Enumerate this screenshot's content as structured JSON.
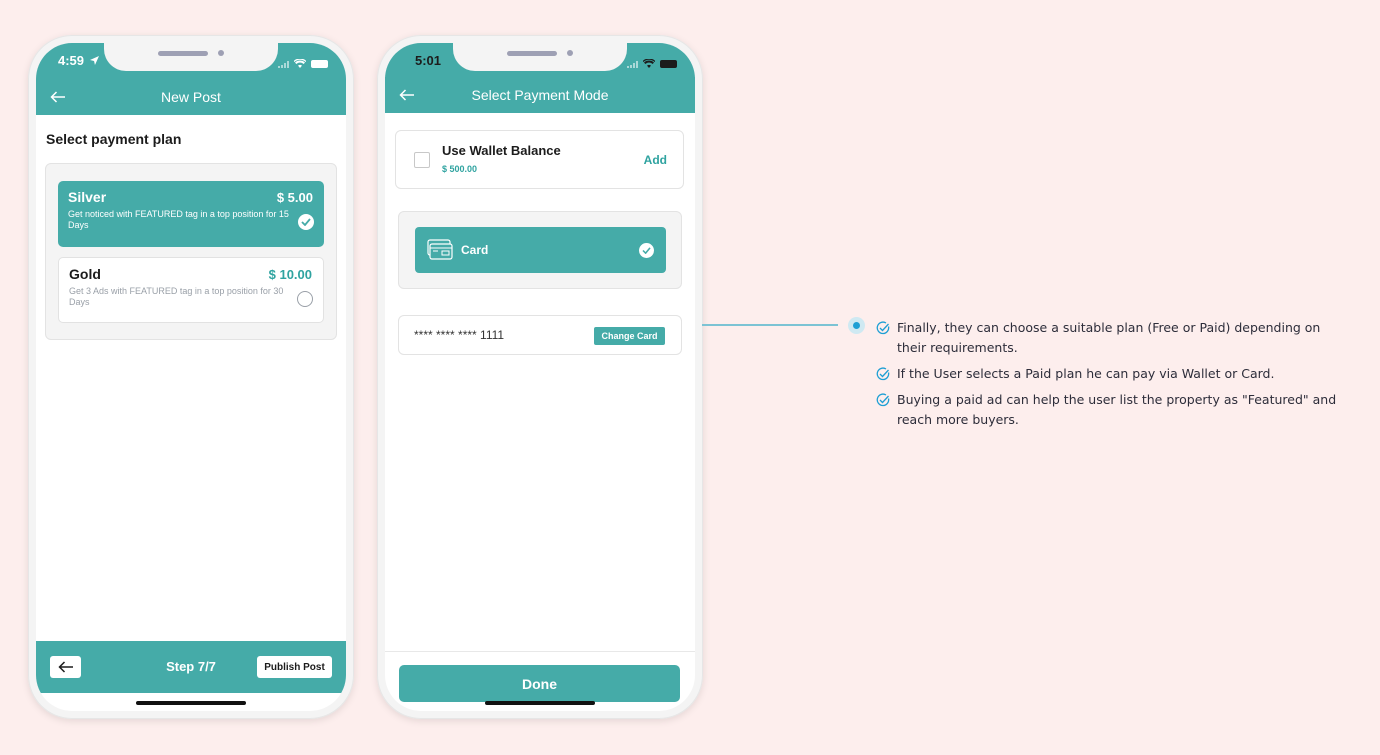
{
  "colors": {
    "primary": "#45aba8",
    "accent_text": "#2fa3a0",
    "background": "#fdeeed",
    "connector": "#7cc3d4",
    "bullet_dot": "#1e9fd4"
  },
  "phone1": {
    "status_time": "4:59",
    "header": {
      "title": "New Post",
      "back_icon": "arrow-left-icon"
    },
    "section_title": "Select payment plan",
    "plans": [
      {
        "name": "Silver",
        "price": "$ 5.00",
        "description": "Get noticed with FEATURED tag in a top position for 15 Days",
        "selected": true
      },
      {
        "name": "Gold",
        "price": "$ 10.00",
        "description": "Get 3 Ads with FEATURED tag in a top position for 30 Days",
        "selected": false
      }
    ],
    "footer": {
      "step_label": "Step 7/7",
      "publish_label": "Publish Post",
      "back_icon": "arrow-left-icon"
    }
  },
  "phone2": {
    "status_time": "5:01",
    "header": {
      "title": "Select Payment Mode",
      "back_icon": "arrow-left-icon"
    },
    "wallet": {
      "label": "Use Wallet Balance",
      "amount": "$ 500.00",
      "add_label": "Add",
      "checked": false
    },
    "card_option": {
      "label": "Card",
      "icon": "credit-card-icon",
      "selected": true
    },
    "saved_card": {
      "masked_number": "**** **** **** 1111",
      "change_label": "Change Card"
    },
    "done_label": "Done"
  },
  "annotation": {
    "notes": [
      "Finally, they can choose a suitable plan (Free or Paid) depending on their requirements.",
      "If the User selects a Paid plan he can pay via Wallet or Card.",
      "Buying a paid ad can help the user list the property as \"Featured\" and reach more buyers."
    ]
  }
}
